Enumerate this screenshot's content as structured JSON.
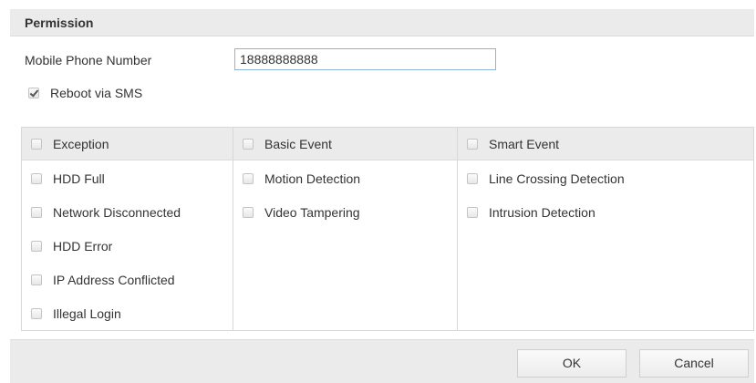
{
  "header": {
    "title": "Permission"
  },
  "phone": {
    "label": "Mobile Phone Number",
    "value": "18888888888"
  },
  "reboot": {
    "label": "Reboot via SMS",
    "checked": true
  },
  "columns": [
    {
      "title": "Exception",
      "items": [
        "HDD Full",
        "Network Disconnected",
        "HDD Error",
        "IP Address Conflicted",
        "Illegal Login"
      ]
    },
    {
      "title": "Basic Event",
      "items": [
        "Motion Detection",
        "Video Tampering"
      ]
    },
    {
      "title": "Smart Event",
      "items": [
        "Line Crossing Detection",
        "Intrusion Detection"
      ]
    }
  ],
  "footer": {
    "ok_label": "OK",
    "cancel_label": "Cancel"
  }
}
